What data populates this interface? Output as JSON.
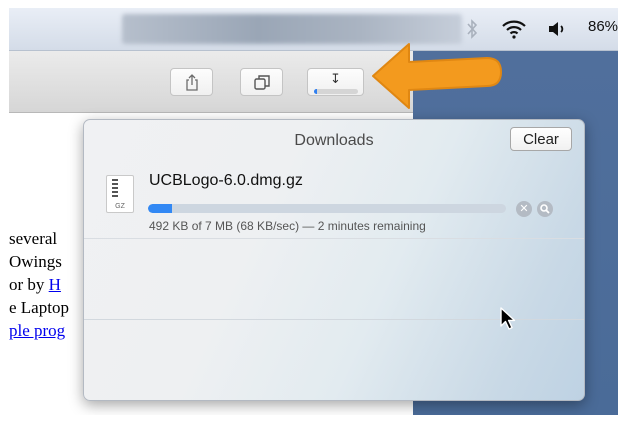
{
  "menubar": {
    "battery_text": "86%",
    "icons": [
      "bluetooth-icon",
      "wifi-icon",
      "volume-icon"
    ]
  },
  "toolbar": {
    "buttons": [
      "share-icon",
      "tabs-icon",
      "downloads-icon"
    ],
    "download_mini_progress": 0.07
  },
  "page": {
    "lines": [
      {
        "text": "several",
        "link": false
      },
      {
        "text": "Owings",
        "link": false
      },
      {
        "prefix": "or by ",
        "link_text": "H"
      },
      {
        "text": "e Laptop",
        "link": false
      },
      {
        "link_text": "ple prog"
      }
    ]
  },
  "downloads": {
    "title": "Downloads",
    "clear_label": "Clear",
    "items": [
      {
        "file_name": "UCBLogo-6.0.dmg.gz",
        "file_type": "GZ",
        "progress": 0.068,
        "status": "492 KB of 7 MB (68 KB/sec) — 2 minutes remaining"
      }
    ]
  },
  "colors": {
    "accent_progress": "#3288f4",
    "orange_arrow": "#f39a1e",
    "desktop_blue": "#4a6c9c"
  }
}
